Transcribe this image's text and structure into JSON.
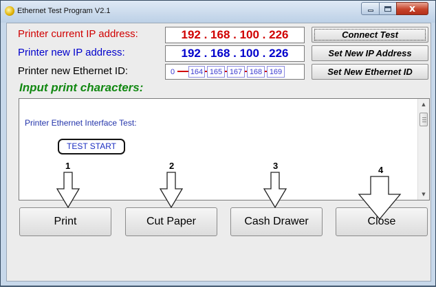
{
  "window": {
    "title": "Ethernet Test Program  V2.1",
    "close_glyph": "x"
  },
  "fields": {
    "current_ip_label": "Printer current IP address:",
    "current_ip": "192 . 168 . 100 . 226",
    "new_ip_label": "Printer new IP address:",
    "new_ip": "192 . 168 . 100 . 226",
    "eth_label": "Printer new Ethernet ID:",
    "eth_segments": [
      "0",
      "164",
      "165",
      "167",
      "168",
      "169"
    ]
  },
  "buttons": {
    "connect_test": "Connect Test",
    "set_new_ip": "Set New IP Address",
    "set_new_eth": "Set New Ethernet ID",
    "print": "Print",
    "cut_paper": "Cut Paper",
    "cash_drawer": "Cash Drawer",
    "close": "Close"
  },
  "input": {
    "title": "Input print characters:",
    "line1": "Printer Ethernet Interface Test:",
    "test_start": "TEST START"
  },
  "annotations": [
    "1",
    "2",
    "3",
    "4"
  ],
  "colors": {
    "current_ip": "#d00000",
    "new_ip": "#0000cc",
    "input_title": "#118811",
    "text_blue": "#2233aa"
  }
}
